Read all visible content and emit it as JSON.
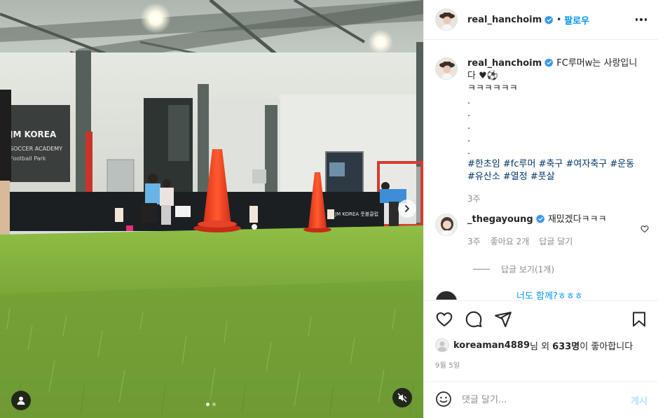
{
  "header": {
    "username": "real_hanchoim",
    "separator": "•",
    "follow_label": "팔로우"
  },
  "caption": {
    "username": "real_hanchoim",
    "lines": [
      "FC루머w는 사랑입니다 ♥⚽",
      "ㅋㅋㅋㅋㅋㅋ",
      ".",
      ".",
      ".",
      ".",
      "."
    ],
    "hashtags": "#한초임 #fc루머 #축구 #여자축구 #운동 #유산소 #열정 #풋살",
    "time": "3주"
  },
  "comments": [
    {
      "username": "_thegayoung",
      "text": "재밌겠다ㅋㅋㅋ",
      "time": "3주",
      "likes": "좋아요 2개",
      "reply_label": "답글 달기",
      "view_replies": "답글 보기(1개)"
    },
    {
      "partial": "너도 함께?ㅎㅎㅎ"
    }
  ],
  "likes": {
    "user": "koreaman4889",
    "suffix_1": "님 외 ",
    "count": "633명",
    "suffix_2": "이 좋아합니다"
  },
  "date": "9월 5일",
  "add_comment": {
    "placeholder": "댓글 달기...",
    "post_label": "게시"
  },
  "media": {
    "banner_text_1": "JM KOREA",
    "banner_text_2": "SOCCER ACADEMY",
    "banner_text_3": "Football Park",
    "board_text": "JM KOREA 풋볼클럽",
    "slide_count": 2,
    "active_slide": 0
  },
  "colors": {
    "accent": "#0095f6",
    "hashtag": "#00376b",
    "muted": "#8e8e8e",
    "cone": "#f0401e",
    "turf": "#7fae3a"
  },
  "icons": [
    "verified-icon",
    "more-options-icon",
    "heart-icon",
    "comment-icon",
    "share-icon",
    "bookmark-icon",
    "emoji-icon",
    "user-tag-icon",
    "mute-icon",
    "chevron-right-icon"
  ]
}
